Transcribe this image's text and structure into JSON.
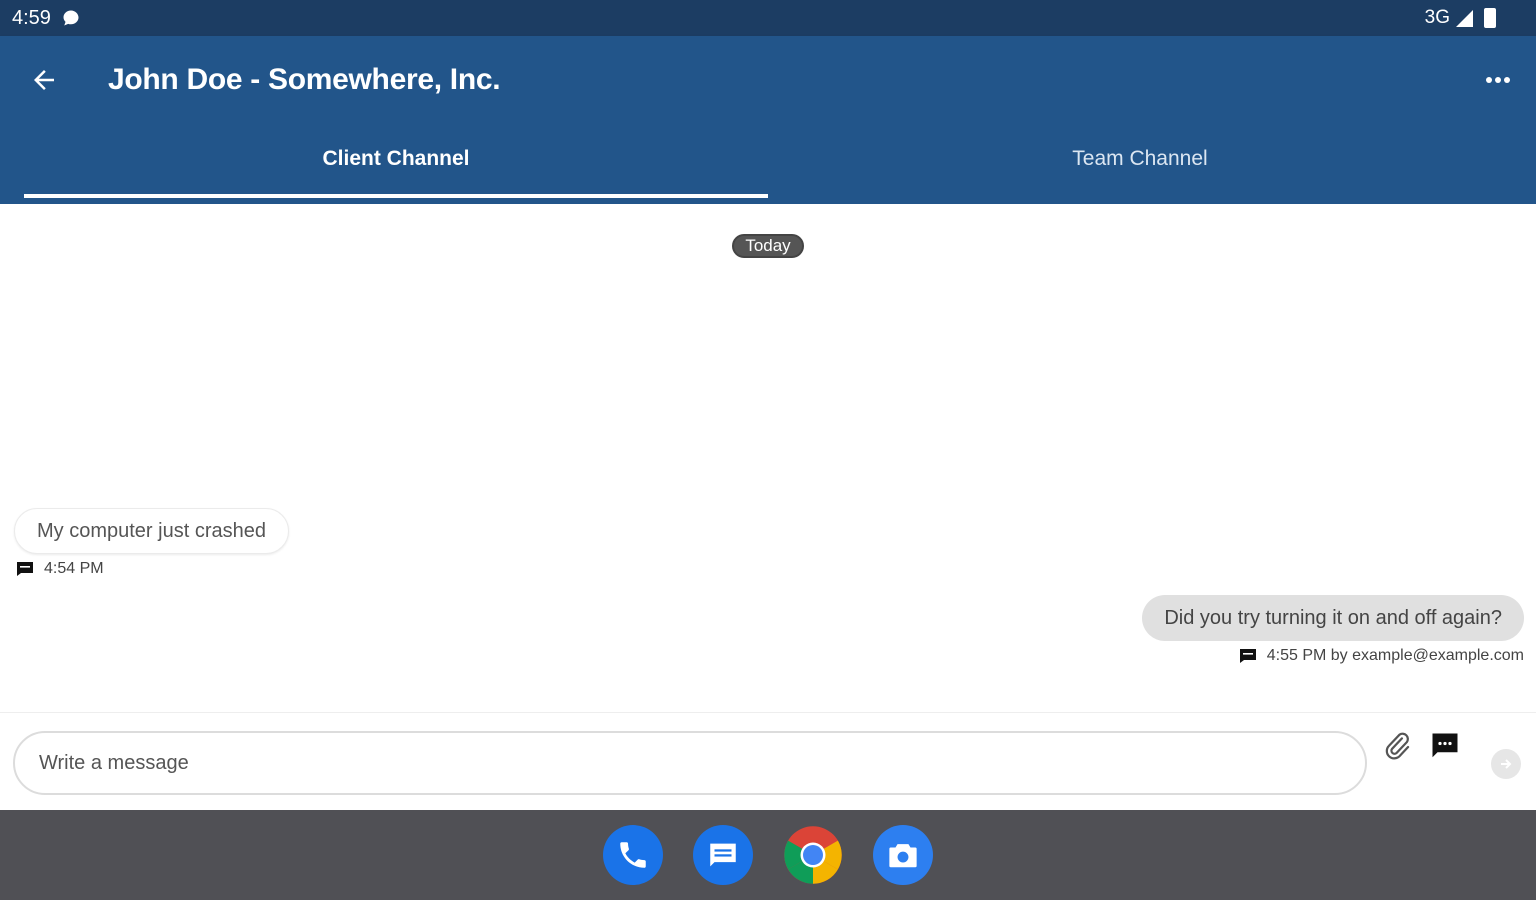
{
  "status_bar": {
    "time": "4:59",
    "network": "3G",
    "icons": [
      "chat-bubble-icon",
      "signal-icon",
      "battery-icon"
    ]
  },
  "app_bar": {
    "title": "John Doe - Somewhere, Inc.",
    "back_icon": "arrow-left-icon",
    "more_icon": "more-horizontal-icon",
    "color": "#22558a"
  },
  "tabs": [
    {
      "label": "Client Channel",
      "selected": true
    },
    {
      "label": "Team Channel",
      "selected": false
    }
  ],
  "chat": {
    "date_divider": "Today",
    "messages": [
      {
        "direction": "incoming",
        "text": "My computer just crashed",
        "meta": "4:54 PM"
      },
      {
        "direction": "outgoing",
        "text": "Did you try turning it on and off again?",
        "meta": "4:55 PM by example@example.com"
      }
    ]
  },
  "composer": {
    "placeholder": "Write a message",
    "value": "",
    "icons": [
      "paperclip-icon",
      "message-template-icon",
      "send-icon"
    ]
  },
  "dock": {
    "apps": [
      "phone-icon",
      "messages-icon",
      "chrome-icon",
      "camera-icon"
    ]
  }
}
